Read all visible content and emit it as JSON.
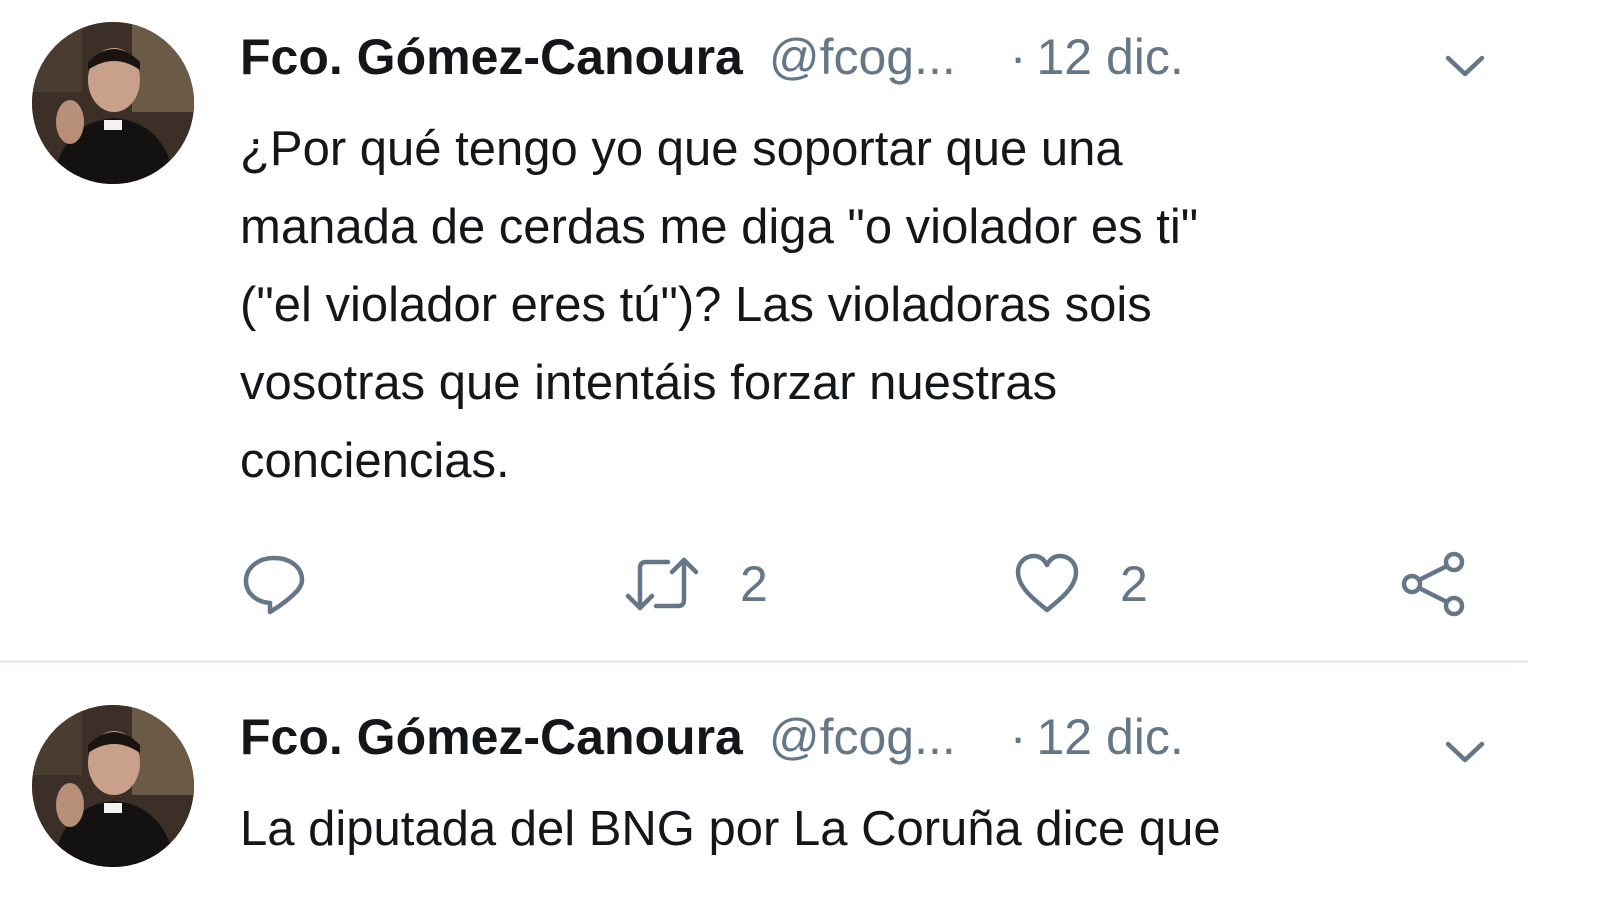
{
  "tweets": [
    {
      "author": {
        "display_name": "Fco. Gómez-Canoura",
        "handle": "@fcog...",
        "avatar_icon": "avatar-photo"
      },
      "separator": "·",
      "date": "12 dic.",
      "text_lines": [
        "¿Por qué tengo yo que soportar que una",
        "manada de cerdas me diga \"o violador es ti\"",
        "(\"el violador eres tú\")? Las violadoras sois",
        "vosotras que intentáis forzar nuestras",
        "conciencias."
      ],
      "actions": {
        "reply_icon": "reply-icon",
        "retweet_icon": "retweet-icon",
        "retweet_count": "2",
        "like_icon": "heart-icon",
        "like_count": "2",
        "share_icon": "share-icon"
      }
    },
    {
      "author": {
        "display_name": "Fco. Gómez-Canoura",
        "handle": "@fcog...",
        "avatar_icon": "avatar-photo"
      },
      "separator": "·",
      "date": "12 dic.",
      "text_lines": [
        "La diputada del BNG por La Coruña dice que"
      ]
    }
  ],
  "colors": {
    "text_primary": "#14171a",
    "text_secondary": "#657786",
    "divider": "#e6ecf0",
    "background": "#ffffff"
  }
}
